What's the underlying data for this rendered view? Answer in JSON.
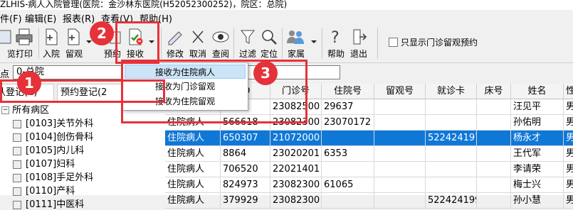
{
  "title": "ZLHIS-病人入院管理(医院：金沙林东医院(H52052300252)，院区：总院)",
  "menu": [
    "件(F)",
    "编辑(E)",
    "报表(R)",
    "查看(V)",
    "帮助(H)"
  ],
  "toolbar": {
    "b1": "览",
    "print": "打印",
    "admit": "入院",
    "observe": "留观",
    "prebook": "预约",
    "receive": "接收",
    "modify": "修改",
    "cancel": "取消",
    "query": "查阅",
    "filter": "过滤",
    "locate": "定位",
    "family": "家属",
    "help": "帮助",
    "exit": "退出",
    "checkbox_label": "只显示门诊留观预约"
  },
  "site": {
    "label": "点",
    "value": "0-总院"
  },
  "tabs": [
    "认登记(1)",
    "预约登记(2"
  ],
  "tree": {
    "root": "所有病区",
    "items": [
      "[0103]关节外科",
      "[0104]创伤骨科",
      "[0105]内儿科",
      "[0107]妇科",
      "[0108]手足外科",
      "[0110]产科",
      "[0111]中医科"
    ]
  },
  "dropdown": [
    "接收为住院病人",
    "接收为门诊留观",
    "接收为住院留观"
  ],
  "grid": {
    "headers": [
      "",
      "ID",
      "门诊号",
      "住院号",
      "留观号",
      "就诊卡",
      "床号",
      "姓名",
      "性"
    ],
    "rows": [
      [
        "",
        "",
        "23082500",
        "29637",
        "",
        "",
        "",
        "汪见平",
        "男"
      ],
      [
        "住院病人",
        "566618",
        "23082300",
        "23070172",
        "",
        "",
        "",
        "孙佑明",
        "男"
      ],
      [
        "住院病人",
        "650307",
        "21072000",
        "",
        "",
        "522424197",
        "",
        "杨永才",
        "男"
      ],
      [
        "住院病人",
        "8864",
        "23020201",
        "6353",
        "",
        "",
        "",
        "王代军",
        "男"
      ],
      [
        "住院病人",
        "706520",
        "22021401",
        "",
        "",
        "",
        "",
        "李请荣",
        "男"
      ],
      [
        "住院病人",
        "824973",
        "23082300",
        "61065",
        "",
        "",
        "",
        "梅士兴",
        "男"
      ],
      [
        "住院病人",
        "379929",
        "23082300",
        "",
        "",
        "522424199",
        "",
        "孙小慧",
        "男"
      ]
    ]
  },
  "badges": [
    "2",
    "1",
    "3"
  ],
  "colors": {
    "highlight": "#0f78d7",
    "annotation": "#e5323a",
    "menu_hover": "#cce4f7"
  }
}
